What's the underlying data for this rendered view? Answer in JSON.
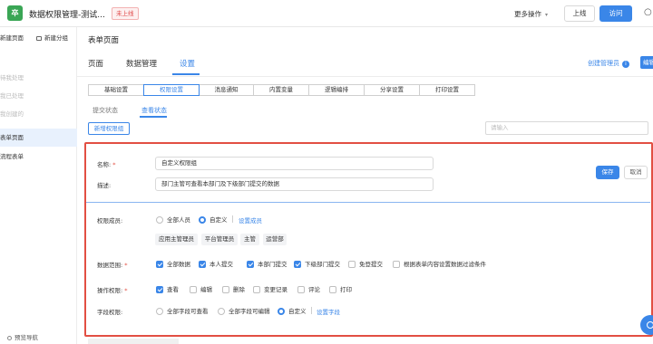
{
  "app": {
    "logo_char": "卒",
    "title": "数据权限管理-测试...",
    "status": "未上线",
    "more_ops": "更多操作",
    "online_btn": "上线",
    "visit_btn": "访问"
  },
  "sidebar": {
    "new_page": "新建页面",
    "new_group": "新建分组",
    "items": [
      {
        "label": "待我处理"
      },
      {
        "label": "我已处理"
      },
      {
        "label": "我创建的"
      },
      {
        "label": "抄送我的"
      },
      {
        "label": "表单页面"
      },
      {
        "label": "流程表单"
      }
    ],
    "bottom_nav": "预览导航"
  },
  "page": {
    "title": "表单页面",
    "tabs": [
      "页面",
      "数据管理",
      "设置"
    ],
    "active_tab": "设置",
    "create_admin": "创建管理员",
    "edit_btn": "编辑"
  },
  "subtabs": [
    "基础设置",
    "权限设置",
    "消息通知",
    "内置变量",
    "逻辑编排",
    "分享设置",
    "打印设置"
  ],
  "view_tabs": [
    "提交状态",
    "查看状态"
  ],
  "toolbar": {
    "add_group": "新增权限组",
    "search_placeholder": "请输入"
  },
  "form": {
    "name_label": "名称:",
    "name_value": "自定义权限组",
    "desc_label": "描述:",
    "desc_value": "部门主管可查看本部门及下级部门提交的数据",
    "save": "保存",
    "cancel": "取消",
    "members_label": "权限成员:",
    "members_options": [
      "全部人员",
      "自定义"
    ],
    "members_selected": "自定义",
    "set_members": "设置成员",
    "member_tags": [
      "应用主管理员",
      "平台管理员",
      "主管",
      "运营部"
    ],
    "scope_label": "数据范围:",
    "scope_options": [
      {
        "label": "全部数据",
        "checked": true
      },
      {
        "label": "本人提交",
        "checked": true
      },
      {
        "label": "本部门提交",
        "checked": true
      },
      {
        "label": "下级部门提交",
        "checked": true
      },
      {
        "label": "免登提交",
        "checked": false
      },
      {
        "label": "根据表单内容设置数据过滤条件",
        "checked": false
      }
    ],
    "ops_label": "操作权限:",
    "ops_options": [
      {
        "label": "查看",
        "checked": true
      },
      {
        "label": "编辑",
        "checked": false
      },
      {
        "label": "删除",
        "checked": false
      },
      {
        "label": "变更记录",
        "checked": false
      },
      {
        "label": "评论",
        "checked": false
      },
      {
        "label": "打印",
        "checked": false
      }
    ],
    "fields_label": "字段权限:",
    "fields_options": [
      "全部字段可查看",
      "全部字段可编辑",
      "自定义"
    ],
    "fields_selected": "自定义",
    "set_fields": "设置字段"
  },
  "colors": {
    "accent": "#3a86e8",
    "highlight": "#e24f43",
    "brand": "#3aa655"
  }
}
